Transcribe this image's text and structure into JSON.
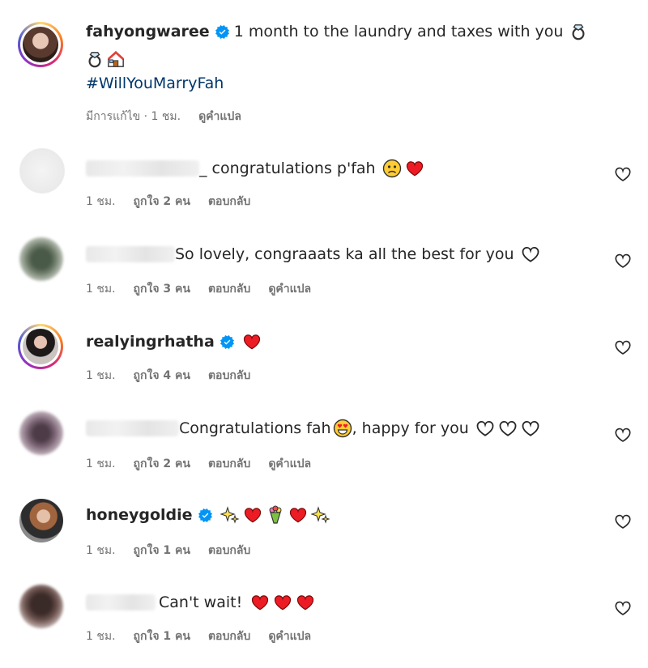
{
  "post": {
    "username": "fahyongwaree",
    "caption": "1 month to the laundry and taxes with you",
    "caption_emojis_line1": "ring-icon",
    "caption_emojis_line2": [
      "ring-icon",
      "house-icon"
    ],
    "hashtag": "#WillYouMarryFah",
    "edited": "มีการแก้ไข · 1 ชม.",
    "translate": "ดูคำแปล"
  },
  "comments": [
    {
      "username": "",
      "text": "_ congratulations p'fah",
      "time": "1 ชม.",
      "likes": "ถูกใจ 2 คน",
      "reply": "ตอบกลับ",
      "translate": ""
    },
    {
      "username": "",
      "text": "So lovely, congraaats ka all the best for you",
      "time": "1 ชม.",
      "likes": "ถูกใจ 3 คน",
      "reply": "ตอบกลับ",
      "translate": "ดูคำแปล"
    },
    {
      "username": "realyingrhatha",
      "text": "",
      "time": "1 ชม.",
      "likes": "ถูกใจ 4 คน",
      "reply": "ตอบกลับ",
      "translate": ""
    },
    {
      "username": "",
      "text": "Congratulations fah",
      "text2": ", happy for you",
      "time": "1 ชม.",
      "likes": "ถูกใจ 2 คน",
      "reply": "ตอบกลับ",
      "translate": "ดูคำแปล"
    },
    {
      "username": "honeygoldie",
      "text": "",
      "time": "1 ชม.",
      "likes": "ถูกใจ 1 คน",
      "reply": "ตอบกลับ",
      "translate": ""
    },
    {
      "username": "",
      "text": "Can't wait!",
      "time": "1 ชม.",
      "likes": "ถูกใจ 1 คน",
      "reply": "ตอบกลับ",
      "translate": "ดูคำแปล"
    }
  ],
  "colors": {
    "verified": "#0095f6",
    "heart": "#ed1c24",
    "meta": "#737373",
    "hashtag": "#00376b"
  }
}
